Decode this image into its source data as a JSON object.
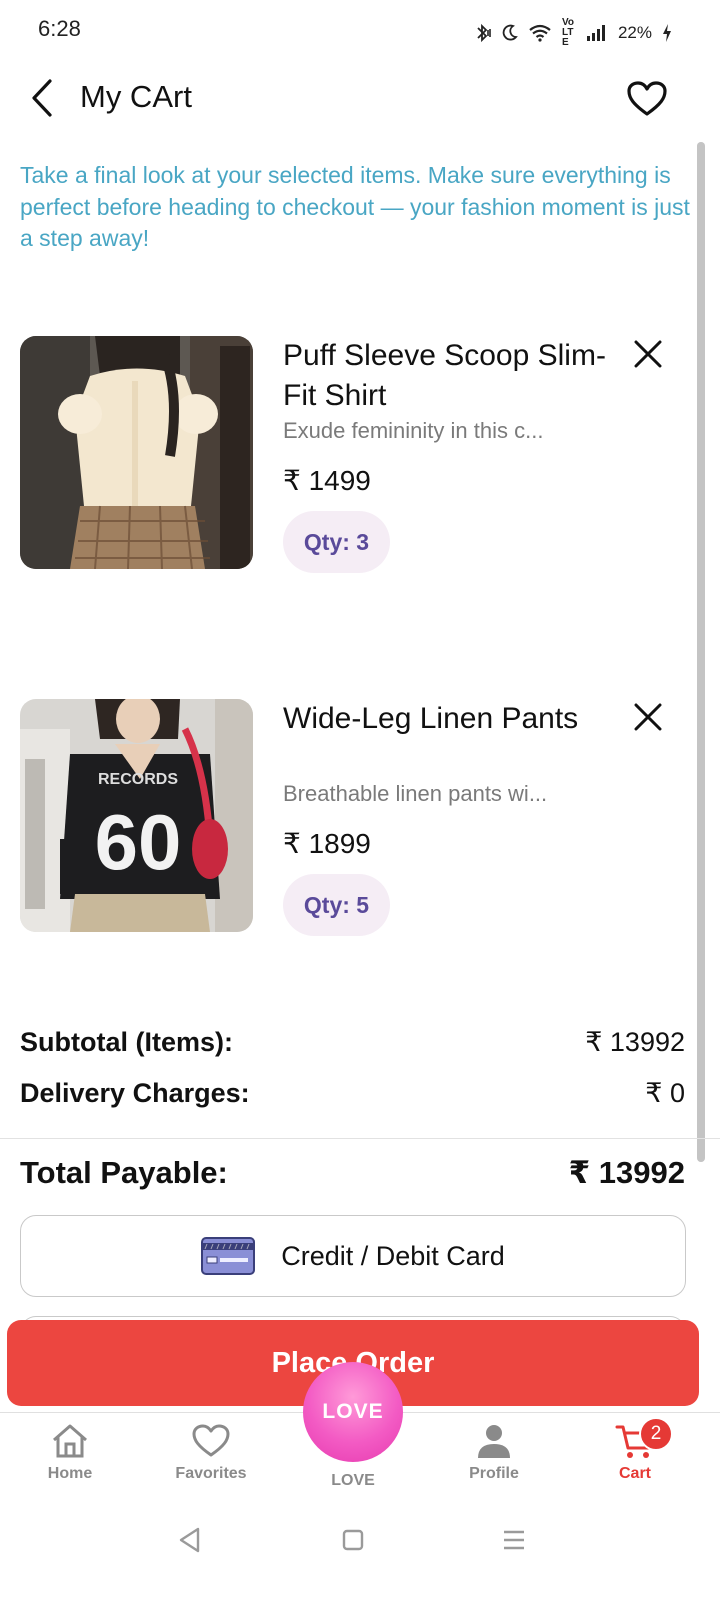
{
  "status_bar": {
    "time": "6:28",
    "battery": "22%",
    "network_label": "Vo LTE",
    "icons": [
      "bluetooth-icon",
      "moon-icon",
      "wifi-icon",
      "volte-icon",
      "signal-icon",
      "battery-charging-icon"
    ]
  },
  "header": {
    "title": "My CArt",
    "back_icon": "chevron-left-icon",
    "favorite_icon": "heart-outline-icon"
  },
  "intro_text": "Take a final look at your selected items. Make sure everything is perfect before heading to checkout — your fashion moment is just a step away!",
  "colors": {
    "accent_text": "#49a6c4",
    "primary_red": "#ec4640",
    "qty_text": "#5a4a9a",
    "qty_bg": "#f5edf5",
    "love_pink": "#f35bc4"
  },
  "items": [
    {
      "name": "Puff Sleeve Scoop Slim-Fit Shirt",
      "description": "Exude femininity in this c...",
      "price": "₹ 1499",
      "qty": "Qty: 3"
    },
    {
      "name": "Wide-Leg Linen Pants",
      "description": "Breathable linen pants wi...",
      "price": "₹ 1899",
      "qty": "Qty: 5"
    }
  ],
  "summary": {
    "subtotal_label": "Subtotal (Items):",
    "subtotal_value": "₹ 13992",
    "delivery_label": "Delivery Charges:",
    "delivery_value": "₹ 0",
    "total_label": "Total Payable:",
    "total_value": "₹ 13992"
  },
  "payment": {
    "method_label": "Credit / Debit Card",
    "icon": "credit-card-icon"
  },
  "place_order_label": "Place Order",
  "bottom_nav": {
    "items": [
      {
        "label": "Home",
        "icon": "home-icon"
      },
      {
        "label": "Favorites",
        "icon": "heart-icon"
      },
      {
        "label": "LOVE",
        "icon": "love-bubble"
      },
      {
        "label": "Profile",
        "icon": "person-icon"
      },
      {
        "label": "Cart",
        "icon": "cart-icon",
        "active": true
      }
    ],
    "love_button_text": "LOVE",
    "cart_badge_count": "2"
  },
  "system_nav": {
    "icons": [
      "back-triangle-icon",
      "home-square-icon",
      "recents-menu-icon"
    ]
  }
}
